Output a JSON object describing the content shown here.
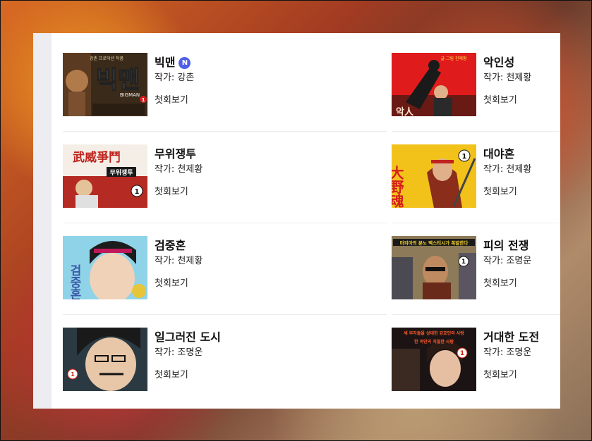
{
  "left_column": [
    {
      "title": "빅맨",
      "author": "작가: 강촌",
      "first_view": "첫회보기",
      "badge": "N",
      "cover_text": "빅맨",
      "cover_sub": "BIGMAN",
      "cover_top": "강촌 프로덕션 작품"
    },
    {
      "title": "무위쟁투",
      "author": "작가: 천제황",
      "first_view": "첫회보기",
      "cover_text": "武威爭鬥",
      "cover_sub": "무위쟁투"
    },
    {
      "title": "검중혼",
      "author": "작가: 천제황",
      "first_view": "첫회보기",
      "cover_text": "검중혼"
    },
    {
      "title": "일그러진 도시",
      "author": "작가: 조명운",
      "first_view": "첫회보기"
    }
  ],
  "right_column": [
    {
      "title": "악인성",
      "author": "작가: 천제황",
      "first_view": "첫회보기",
      "cover_text": "글·그림 천제황",
      "cover_sub": "악人"
    },
    {
      "title": "대야혼",
      "author": "작가: 천제황",
      "first_view": "첫회보기",
      "cover_text": "大野魂"
    },
    {
      "title": "피의 전쟁",
      "author": "작가: 조명운",
      "first_view": "첫회보기",
      "cover_text": "마피아의 분노 맥스티시가 폭발한다"
    },
    {
      "title": "거대한 도전",
      "author": "작가: 조명운",
      "first_view": "첫회보기",
      "cover_text": "세 부자들을 상대한 강호인의 사랑",
      "cover_sub": "한 여인의 처절한 사랑"
    }
  ],
  "cover_badge": "1",
  "colors": {
    "new_badge": "#4f5fe8",
    "panel_bg": "#ffffff",
    "strip": "#ececf1"
  }
}
